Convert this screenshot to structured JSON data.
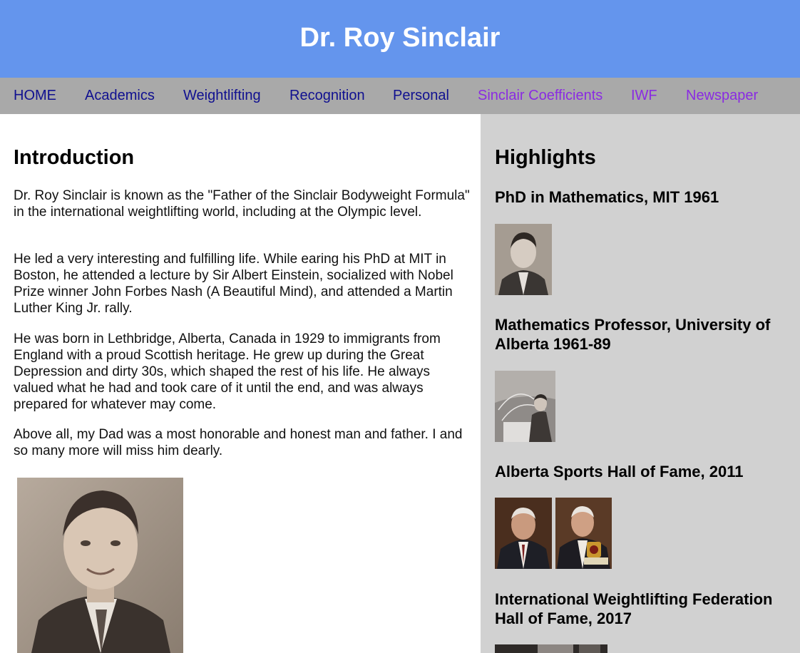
{
  "site": {
    "title": "Dr. Roy Sinclair"
  },
  "nav": {
    "items": [
      {
        "label": "HOME",
        "state": "unvisited"
      },
      {
        "label": "Academics",
        "state": "unvisited"
      },
      {
        "label": "Weightlifting",
        "state": "unvisited"
      },
      {
        "label": "Recognition",
        "state": "unvisited"
      },
      {
        "label": "Personal",
        "state": "unvisited"
      },
      {
        "label": "Sinclair Coefficients",
        "state": "visited"
      },
      {
        "label": "IWF",
        "state": "visited"
      },
      {
        "label": "Newspaper",
        "state": "visited"
      }
    ]
  },
  "main": {
    "heading": "Introduction",
    "paragraphs": [
      "Dr. Roy Sinclair is known as the \"Father of the Sinclair Bodyweight Formula\" in the international weightlifting world, including at the Olympic level.",
      "He led a very interesting and fulfilling life. While earing his PhD at MIT in Boston, he attended a lecture by Sir Albert Einstein, socialized with Nobel Prize winner John Forbes Nash (A Beautiful Mind), and attended a Martin Luther King Jr. rally.",
      "He was born in Lethbridge, Alberta, Canada in 1929 to immigrants from England with a proud Scottish heritage. He grew up during the Great Depression and dirty 30s, which shaped the rest of his life. He always valued what he had and took care of it until the end, and was always prepared for whatever may come.",
      "Above all, my Dad was a most honorable and honest man and father. I and so many more will miss him dearly."
    ]
  },
  "aside": {
    "heading": "Highlights",
    "highlights": [
      "PhD in Mathematics, MIT 1961",
      "Mathematics Professor, University of Alberta 1961-89",
      "Alberta Sports Hall of Fame, 2011",
      "International Weightlifting Federation Hall of Fame, 2017"
    ]
  },
  "colors": {
    "header_bg": "#6495ed",
    "nav_bg": "#a9a9a9",
    "nav_link": "#101090",
    "nav_link_visited": "#8a2be2",
    "aside_bg": "#d1d1d1"
  }
}
